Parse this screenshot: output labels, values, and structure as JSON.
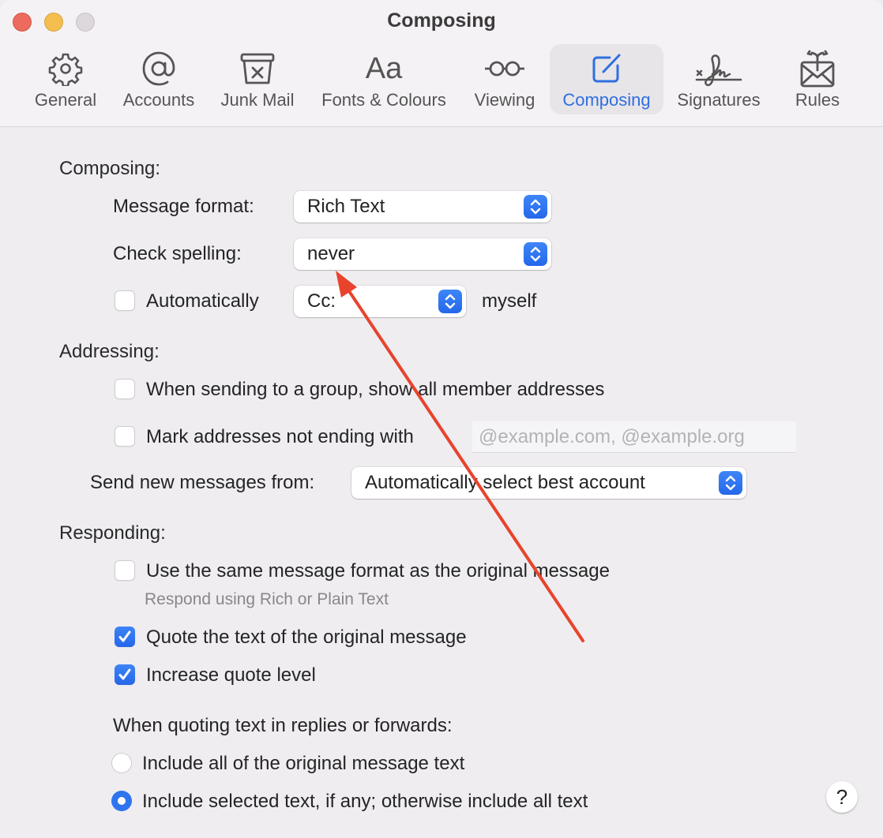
{
  "window": {
    "title": "Composing",
    "controls": [
      "close",
      "minimize",
      "zoom"
    ]
  },
  "toolbar": {
    "tabs": [
      {
        "label": "General",
        "icon": "gear-icon",
        "active": false
      },
      {
        "label": "Accounts",
        "icon": "at-sign-icon",
        "active": false
      },
      {
        "label": "Junk Mail",
        "icon": "junk-bin-icon",
        "active": false
      },
      {
        "label": "Fonts & Colours",
        "icon": "fonts-aa-icon",
        "active": false
      },
      {
        "label": "Viewing",
        "icon": "glasses-icon",
        "active": false
      },
      {
        "label": "Composing",
        "icon": "compose-pencil-icon",
        "active": true
      },
      {
        "label": "Signatures",
        "icon": "signature-icon",
        "active": false
      },
      {
        "label": "Rules",
        "icon": "envelope-rules-icon",
        "active": false
      }
    ],
    "accent_color": "#2f6fe0"
  },
  "composing": {
    "heading": "Composing:",
    "message_format": {
      "label": "Message format:",
      "value": "Rich Text"
    },
    "check_spelling": {
      "label": "Check spelling:",
      "value": "never"
    },
    "auto_cc": {
      "checked": false,
      "label": "Automatically",
      "value": "Cc:",
      "suffix": "myself"
    }
  },
  "addressing": {
    "heading": "Addressing:",
    "show_group_members": {
      "checked": false,
      "label": "When sending to a group, show all member addresses"
    },
    "mark_addresses": {
      "checked": false,
      "label": "Mark addresses not ending with",
      "value": "",
      "placeholder": "@example.com, @example.org"
    },
    "send_from": {
      "label": "Send new messages from:",
      "value": "Automatically select best account"
    }
  },
  "responding": {
    "heading": "Responding:",
    "same_format": {
      "checked": false,
      "label": "Use the same message format as the original message",
      "hint": "Respond using Rich or Plain Text"
    },
    "quote_text": {
      "checked": true,
      "label": "Quote the text of the original message"
    },
    "increase_quote": {
      "checked": true,
      "label": "Increase quote level"
    },
    "quoting_heading": "When quoting text in replies or forwards:",
    "quoting_options": [
      {
        "label": "Include all of the original message text",
        "selected": false
      },
      {
        "label": "Include selected text, if any; otherwise include all text",
        "selected": true
      }
    ]
  },
  "help_button": {
    "label": "?"
  },
  "annotation": {
    "type": "arrow",
    "color": "#e8432d",
    "points_to": "check-spelling-popup"
  }
}
